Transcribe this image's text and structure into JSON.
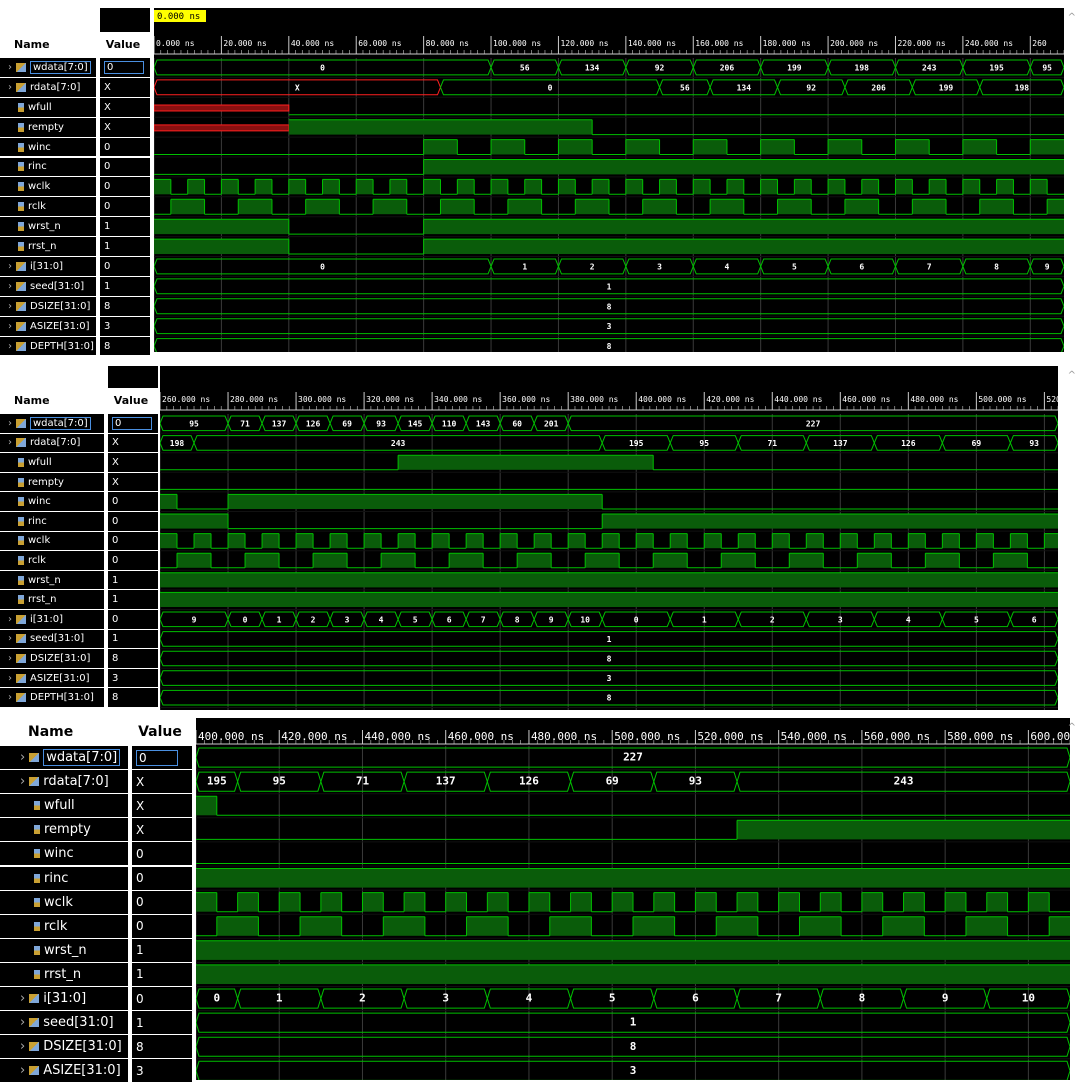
{
  "cursor_label": "0.000 ns",
  "header": {
    "name": "Name",
    "value": "Value"
  },
  "panels": [
    {
      "signals": [
        {
          "name": "wdata[7:0]",
          "value": "0",
          "bus": true,
          "sel": true
        },
        {
          "name": "rdata[7:0]",
          "value": "X",
          "bus": true
        },
        {
          "name": "wfull",
          "value": "X"
        },
        {
          "name": "rempty",
          "value": "X"
        },
        {
          "name": "winc",
          "value": "0"
        },
        {
          "name": "rinc",
          "value": "0"
        },
        {
          "name": "wclk",
          "value": "0"
        },
        {
          "name": "rclk",
          "value": "0"
        },
        {
          "name": "wrst_n",
          "value": "1"
        },
        {
          "name": "rrst_n",
          "value": "1"
        },
        {
          "name": "i[31:0]",
          "value": "0",
          "bus": true
        },
        {
          "name": "seed[31:0]",
          "value": "1",
          "bus": true
        },
        {
          "name": "DSIZE[31:0]",
          "value": "8",
          "bus": true
        },
        {
          "name": "ASIZE[31:0]",
          "value": "3",
          "bus": true
        },
        {
          "name": "DEPTH[31:0]",
          "value": "8",
          "bus": true
        }
      ],
      "ticks": [
        "0.000 ns",
        "20.000 ns",
        "40.000 ns",
        "60.000 ns",
        "80.000 ns",
        "100.000 ns",
        "120.000 ns",
        "140.000 ns",
        "160.000 ns",
        "180.000 ns",
        "200.000 ns",
        "220.000 ns",
        "240.000 ns",
        "260"
      ],
      "buses": {
        "wdata": [
          [
            0,
            100,
            "0"
          ],
          [
            100,
            120,
            "56"
          ],
          [
            120,
            140,
            "134"
          ],
          [
            140,
            160,
            "92"
          ],
          [
            160,
            180,
            "206"
          ],
          [
            180,
            200,
            "199"
          ],
          [
            200,
            220,
            "198"
          ],
          [
            220,
            240,
            "243"
          ],
          [
            240,
            260,
            "195"
          ],
          [
            260,
            270,
            "95"
          ]
        ],
        "rdata": [
          [
            0,
            85,
            "X",
            "x"
          ],
          [
            85,
            150,
            "0"
          ],
          [
            150,
            165,
            "56"
          ],
          [
            165,
            185,
            "134"
          ],
          [
            185,
            205,
            "92"
          ],
          [
            205,
            225,
            "206"
          ],
          [
            225,
            245,
            "199"
          ],
          [
            245,
            270,
            "198"
          ]
        ],
        "i": [
          [
            0,
            100,
            "0"
          ],
          [
            100,
            120,
            "1"
          ],
          [
            120,
            140,
            "2"
          ],
          [
            140,
            160,
            "3"
          ],
          [
            160,
            180,
            "4"
          ],
          [
            180,
            200,
            "5"
          ],
          [
            200,
            220,
            "6"
          ],
          [
            220,
            240,
            "7"
          ],
          [
            240,
            260,
            "8"
          ],
          [
            260,
            270,
            "9"
          ]
        ],
        "seed": [
          [
            0,
            270,
            "1"
          ]
        ],
        "DSIZE": [
          [
            0,
            270,
            "8"
          ]
        ],
        "ASIZE": [
          [
            0,
            270,
            "3"
          ]
        ],
        "DEPTH": [
          [
            0,
            270,
            "8"
          ]
        ]
      }
    },
    {
      "signals": [
        {
          "name": "wdata[7:0]",
          "value": "0",
          "bus": true,
          "sel": true
        },
        {
          "name": "rdata[7:0]",
          "value": "X",
          "bus": true
        },
        {
          "name": "wfull",
          "value": "X"
        },
        {
          "name": "rempty",
          "value": "X"
        },
        {
          "name": "winc",
          "value": "0"
        },
        {
          "name": "rinc",
          "value": "0"
        },
        {
          "name": "wclk",
          "value": "0"
        },
        {
          "name": "rclk",
          "value": "0"
        },
        {
          "name": "wrst_n",
          "value": "1"
        },
        {
          "name": "rrst_n",
          "value": "1"
        },
        {
          "name": "i[31:0]",
          "value": "0",
          "bus": true
        },
        {
          "name": "seed[31:0]",
          "value": "1",
          "bus": true
        },
        {
          "name": "DSIZE[31:0]",
          "value": "8",
          "bus": true
        },
        {
          "name": "ASIZE[31:0]",
          "value": "3",
          "bus": true
        },
        {
          "name": "DEPTH[31:0]",
          "value": "8",
          "bus": true
        }
      ],
      "ticks": [
        "260.000 ns",
        "280.000 ns",
        "300.000 ns",
        "320.000 ns",
        "340.000 ns",
        "360.000 ns",
        "380.000 ns",
        "400.000 ns",
        "420.000 ns",
        "440.000 ns",
        "460.000 ns",
        "480.000 ns",
        "500.000 ns",
        "520"
      ],
      "buses": {
        "wdata": [
          [
            260,
            280,
            "95"
          ],
          [
            280,
            290,
            "71"
          ],
          [
            290,
            300,
            "137"
          ],
          [
            300,
            310,
            "126"
          ],
          [
            310,
            320,
            "69"
          ],
          [
            320,
            330,
            "93"
          ],
          [
            330,
            340,
            "145"
          ],
          [
            340,
            350,
            "110"
          ],
          [
            350,
            360,
            "143"
          ],
          [
            360,
            370,
            "60"
          ],
          [
            370,
            380,
            "201"
          ],
          [
            380,
            524,
            "227"
          ]
        ],
        "rdata": [
          [
            260,
            270,
            "198"
          ],
          [
            270,
            390,
            "243"
          ],
          [
            390,
            410,
            "195"
          ],
          [
            410,
            430,
            "95"
          ],
          [
            430,
            450,
            "71"
          ],
          [
            450,
            470,
            "137"
          ],
          [
            470,
            490,
            "126"
          ],
          [
            490,
            510,
            "69"
          ],
          [
            510,
            524,
            "93"
          ]
        ],
        "i": [
          [
            260,
            280,
            "9"
          ],
          [
            280,
            290,
            "0"
          ],
          [
            290,
            300,
            "1"
          ],
          [
            300,
            310,
            "2"
          ],
          [
            310,
            320,
            "3"
          ],
          [
            320,
            330,
            "4"
          ],
          [
            330,
            340,
            "5"
          ],
          [
            340,
            350,
            "6"
          ],
          [
            350,
            360,
            "7"
          ],
          [
            360,
            370,
            "8"
          ],
          [
            370,
            380,
            "9"
          ],
          [
            380,
            390,
            "10"
          ],
          [
            390,
            410,
            "0"
          ],
          [
            410,
            430,
            "1"
          ],
          [
            430,
            450,
            "2"
          ],
          [
            450,
            470,
            "3"
          ],
          [
            470,
            490,
            "4"
          ],
          [
            490,
            510,
            "5"
          ],
          [
            510,
            524,
            "6"
          ]
        ],
        "seed": [
          [
            260,
            524,
            "1"
          ]
        ],
        "DSIZE": [
          [
            260,
            524,
            "8"
          ]
        ],
        "ASIZE": [
          [
            260,
            524,
            "3"
          ]
        ],
        "DEPTH": [
          [
            260,
            524,
            "8"
          ]
        ]
      }
    },
    {
      "signals": [
        {
          "name": "wdata[7:0]",
          "value": "0",
          "bus": true,
          "sel": true
        },
        {
          "name": "rdata[7:0]",
          "value": "X",
          "bus": true
        },
        {
          "name": "wfull",
          "value": "X"
        },
        {
          "name": "rempty",
          "value": "X"
        },
        {
          "name": "winc",
          "value": "0"
        },
        {
          "name": "rinc",
          "value": "0"
        },
        {
          "name": "wclk",
          "value": "0"
        },
        {
          "name": "rclk",
          "value": "0"
        },
        {
          "name": "wrst_n",
          "value": "1"
        },
        {
          "name": "rrst_n",
          "value": "1"
        },
        {
          "name": "i[31:0]",
          "value": "0",
          "bus": true
        },
        {
          "name": "seed[31:0]",
          "value": "1",
          "bus": true
        },
        {
          "name": "DSIZE[31:0]",
          "value": "8",
          "bus": true
        },
        {
          "name": "ASIZE[31:0]",
          "value": "3",
          "bus": true
        }
      ],
      "ticks": [
        "400.000 ns",
        "420.000 ns",
        "440.000 ns",
        "460.000 ns",
        "480.000 ns",
        "500.000 ns",
        "520.000 ns",
        "540.000 ns",
        "560.000 ns",
        "580.000 ns",
        "600.000"
      ],
      "buses": {
        "wdata": [
          [
            400,
            610,
            "227"
          ]
        ],
        "rdata": [
          [
            400,
            410,
            "195"
          ],
          [
            410,
            430,
            "95"
          ],
          [
            430,
            450,
            "71"
          ],
          [
            450,
            470,
            "137"
          ],
          [
            470,
            490,
            "126"
          ],
          [
            490,
            510,
            "69"
          ],
          [
            510,
            530,
            "93"
          ],
          [
            530,
            610,
            "243"
          ]
        ],
        "i": [
          [
            400,
            410,
            "0"
          ],
          [
            410,
            430,
            "1"
          ],
          [
            430,
            450,
            "2"
          ],
          [
            450,
            470,
            "3"
          ],
          [
            470,
            490,
            "4"
          ],
          [
            490,
            510,
            "5"
          ],
          [
            510,
            530,
            "6"
          ],
          [
            530,
            550,
            "7"
          ],
          [
            550,
            570,
            "8"
          ],
          [
            570,
            590,
            "9"
          ],
          [
            590,
            610,
            "10"
          ]
        ],
        "seed": [
          [
            400,
            610,
            "1"
          ]
        ],
        "DSIZE": [
          [
            400,
            610,
            "8"
          ]
        ],
        "ASIZE": [
          [
            400,
            610,
            "3"
          ]
        ]
      }
    }
  ],
  "colors": {
    "wave": "#00c000",
    "fill": "#0a5c0a",
    "bg": "#000000",
    "text": "#ffffff",
    "grid": "#3a3a3a",
    "x": "#ff2020"
  }
}
